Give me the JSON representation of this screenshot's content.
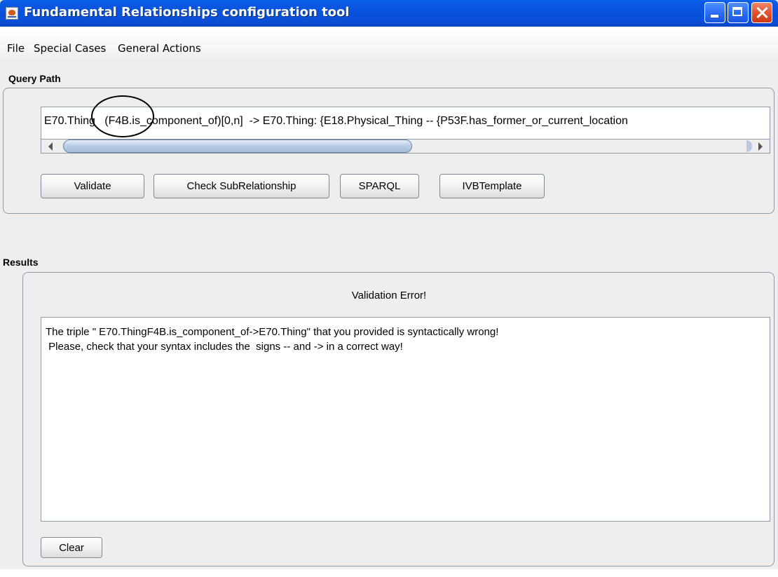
{
  "window": {
    "title": "Fundamental Relationships configuration tool",
    "app_icon": "java-cup-icon",
    "controls": [
      "minimize-icon",
      "maximize-icon",
      "close-icon"
    ],
    "titlebar_color": "#0a52dc",
    "close_color": "#e3532d"
  },
  "menu": {
    "items": [
      "File",
      "Special Cases",
      "General Actions"
    ]
  },
  "query_path": {
    "label": "Query Path",
    "value": "E70.Thing   (F4B.is_component_of)[0,n]  -> E70.Thing: {E18.Physical_Thing -- {P53F.has_former_or_current_location",
    "buttons": {
      "validate": "Validate",
      "check_subrelationship": "Check SubRelationship",
      "sparql": "SPARQL",
      "ivb_template": "IVBTemplate"
    }
  },
  "results": {
    "label": "Results",
    "status": "Validation Error!",
    "lines": [
      "The triple \" E70.ThingF4B.is_component_of->E70.Thing\" that you provided is syntactically wrong!",
      " Please, check that your syntax includes the  signs -- and -> in a correct way!"
    ],
    "clear_label": "Clear"
  }
}
